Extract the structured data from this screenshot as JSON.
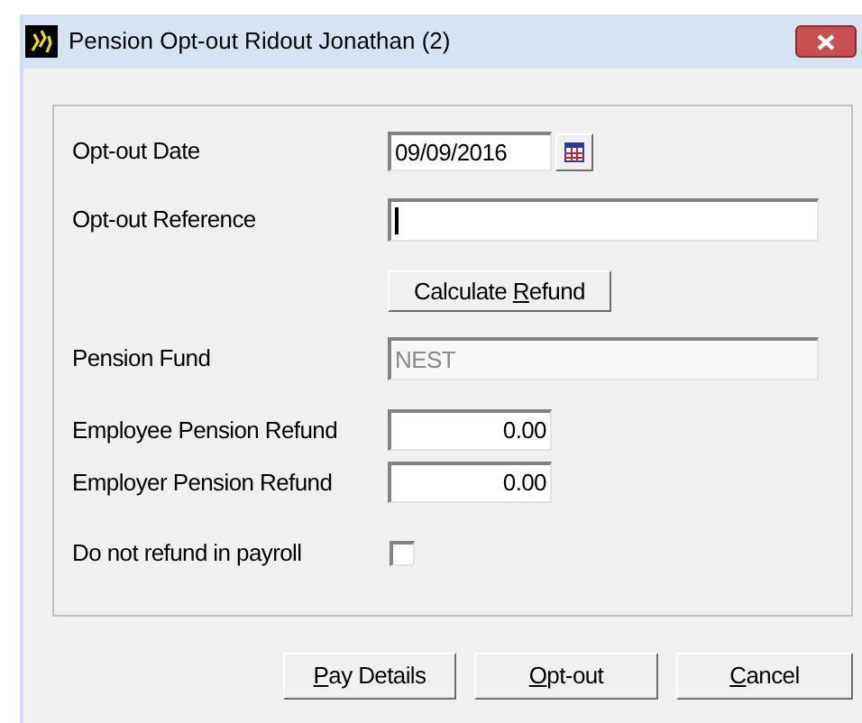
{
  "window": {
    "title": "Pension Opt-out Ridout Jonathan (2)"
  },
  "form": {
    "rows": [
      {
        "kind": "date",
        "label": "Opt-out Date",
        "value": "09/09/2016"
      },
      {
        "kind": "text",
        "label": "Opt-out Reference",
        "focused": true,
        "disabled": false
      },
      {
        "kind": "button",
        "before": "Calculate ",
        "mnemonic": "R",
        "after": "efund"
      },
      {
        "kind": "text",
        "label": "Pension Fund",
        "value": "NEST",
        "focused": false,
        "disabled": true
      },
      {
        "kind": "amount",
        "label": "Employee Pension Refund",
        "value": "0.00"
      },
      {
        "kind": "amount",
        "label": "Employer Pension Refund",
        "value": "0.00"
      },
      {
        "kind": "checkbox",
        "label": "Do not refund in payroll",
        "checked": false
      }
    ]
  },
  "buttons": [
    {
      "mnemonic": "P",
      "after": "ay Details"
    },
    {
      "mnemonic": "O",
      "after": "pt-out"
    },
    {
      "mnemonic": "C",
      "after": "ancel"
    }
  ]
}
